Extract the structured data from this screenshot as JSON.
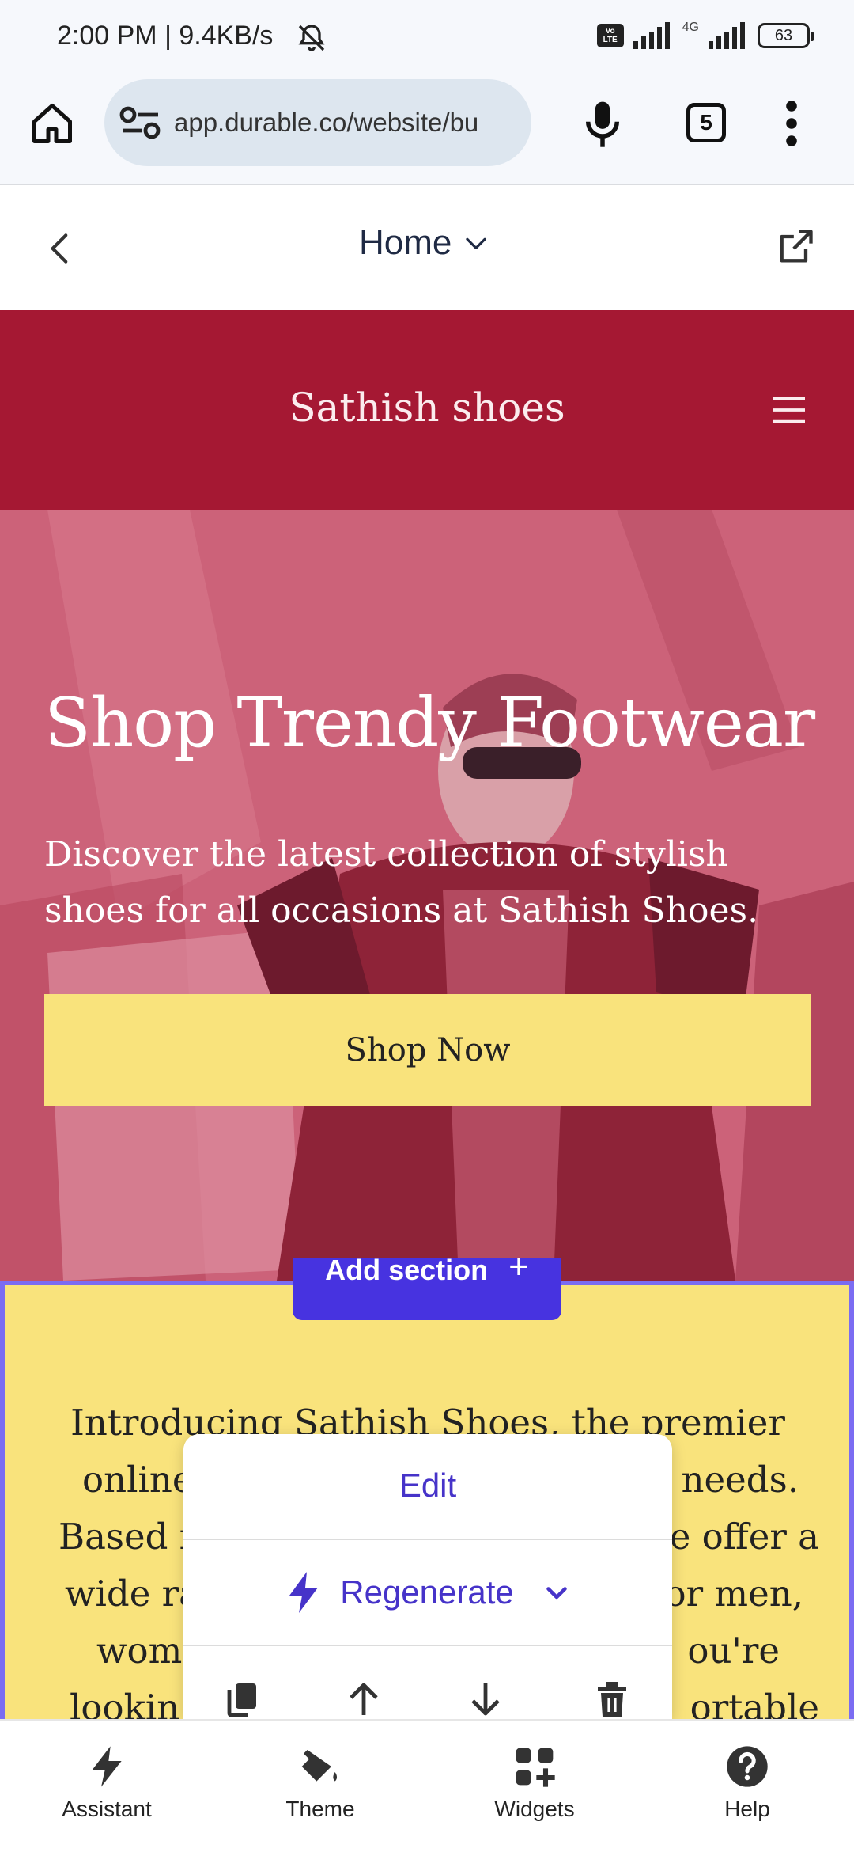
{
  "status_bar": {
    "time": "2:00 PM | 9.4KB/s",
    "network": "4G",
    "volte": "Vo LTE",
    "battery": "63"
  },
  "browser": {
    "url": "app.durable.co/website/bu",
    "tab_count": "5"
  },
  "editor_header": {
    "page_name": "Home"
  },
  "site": {
    "title": "Sathish shoes",
    "hero_title": "Shop Trendy Footwear",
    "hero_subtitle": "Discover the latest collection of stylish shoes for all occasions at Sathish Shoes.",
    "cta_label": "Shop Now",
    "about_lines": [
      "Introducing Sathish Shoes, the premier",
      "online",
      "needs.",
      "Based in",
      "e offer a",
      "wide ra",
      "or men,",
      "wom",
      "ou're",
      "lookin",
      "ortable"
    ]
  },
  "add_section": {
    "label": "Add section",
    "icon": "+"
  },
  "popup": {
    "edit_label": "Edit",
    "regenerate_label": "Regenerate"
  },
  "bottom_nav": {
    "items": [
      {
        "label": "Assistant",
        "icon": "bolt-icon"
      },
      {
        "label": "Theme",
        "icon": "paint-bucket-icon"
      },
      {
        "label": "Widgets",
        "icon": "widgets-icon"
      },
      {
        "label": "Help",
        "icon": "help-icon"
      }
    ]
  },
  "colors": {
    "brand_red": "#a51833",
    "accent_yellow": "#f9e37c",
    "editor_purple": "#4733e0"
  }
}
